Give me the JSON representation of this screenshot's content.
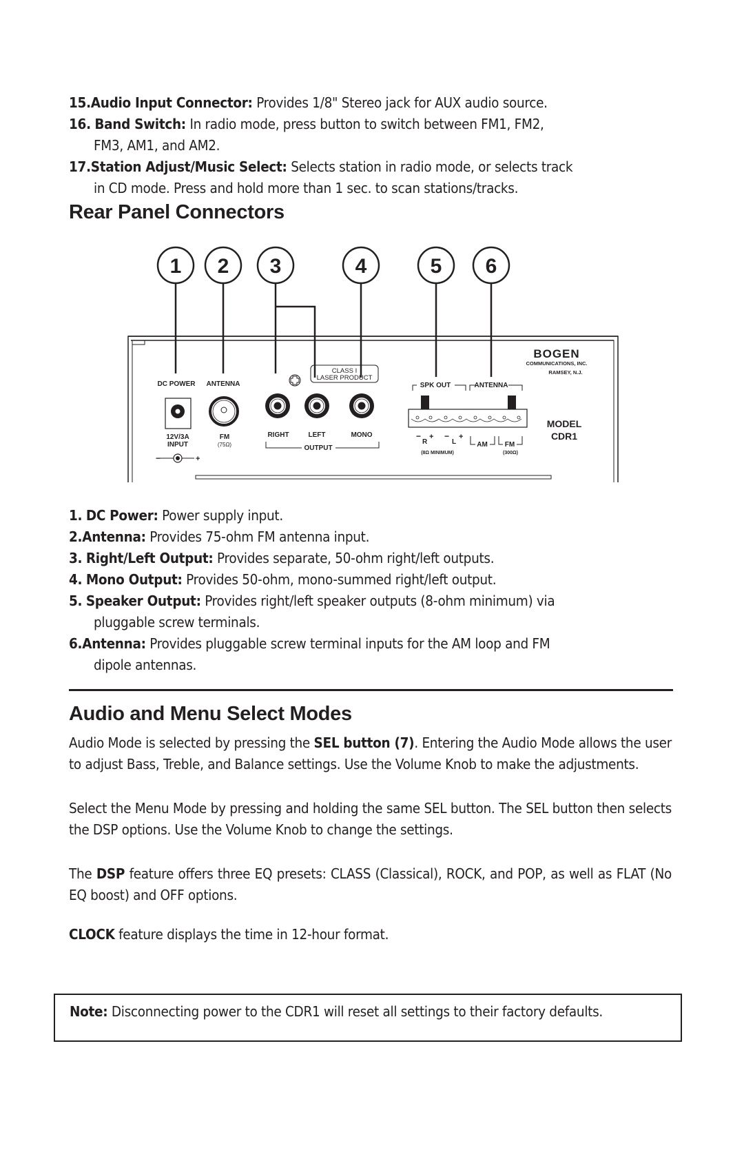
{
  "top_items": [
    {
      "num": "15.",
      "term": "Audio Input Connector:",
      "text": " Provides 1/8\" Stereo jack for AUX audio source.",
      "cont": ""
    },
    {
      "num": "16.",
      "term": "Band Switch:",
      "text": " In radio mode, press button to switch between FM1, FM2,",
      "cont": "FM3,  AM1, and AM2."
    },
    {
      "num": "17.",
      "term": "Station Adjust/Music Select:",
      "text": " Selects station in radio mode, or selects track",
      "cont": "in CD mode. Press and hold more than 1 sec. to scan stations/tracks."
    }
  ],
  "rear_panel": {
    "heading": "Rear Panel Connectors",
    "callouts": [
      "1",
      "2",
      "3",
      "4",
      "5",
      "6"
    ],
    "labels": {
      "dc_power": "DC POWER",
      "antenna": "ANTENNA",
      "dc_rating_1": "12V/3A",
      "dc_rating_2": "INPUT",
      "fm": "FM",
      "fm_ohm": "(75Ω)",
      "right": "RIGHT",
      "left": "LEFT",
      "mono": "MONO",
      "output": "OUTPUT",
      "laser_1": "CLASS I",
      "laser_2": "LASER PRODUCT",
      "spk_out": "SPK OUT",
      "antenna2": "ANTENNA",
      "r": "R",
      "l": "L",
      "am": "AM",
      "fm2": "FM",
      "min": "(8Ω MINIMUM)",
      "fm300": "(300Ω)",
      "brand": "BOGEN",
      "brand_sub": "COMMUNICATIONS, INC.",
      "brand_city": "RAMSEY, N.J.",
      "model_1": "MODEL",
      "model_2": "CDR1",
      "minus": "−",
      "plus": "+"
    }
  },
  "connector_items": [
    {
      "num": "1.",
      "term": "DC Power:",
      "text": " Power supply input.",
      "cont": ""
    },
    {
      "num": "2.",
      "term": "Antenna:",
      "text": " Provides 75-ohm FM antenna input.",
      "cont": ""
    },
    {
      "num": "3.",
      "term": "Right/Left Output:",
      "text": " Provides separate, 50-ohm right/left outputs.",
      "cont": ""
    },
    {
      "num": "4.",
      "term": "Mono Output:",
      "text": " Provides 50-ohm, mono-summed right/left output.",
      "cont": ""
    },
    {
      "num": "5.",
      "term": "Speaker Output:",
      "text": " Provides right/left speaker outputs (8-ohm minimum) via",
      "cont": "pluggable screw terminals."
    },
    {
      "num": "6.",
      "term": "Antenna:",
      "text": " Provides pluggable screw terminal inputs for the AM loop and FM",
      "cont": "dipole antennas."
    }
  ],
  "modes": {
    "heading": "Audio and Menu Select Modes",
    "p1_a": "Audio Mode is selected by pressing the ",
    "p1_b": "SEL button (7)",
    "p1_c": ". Entering the Audio Mode allows the user to adjust Bass, Treble, and Balance settings. Use the Volume Knob to make the adjustments.",
    "p2": "Select the Menu Mode by pressing and holding the same SEL button. The SEL button then selects the DSP options. Use the  Volume Knob to change the settings.",
    "p3_a": "The ",
    "p3_b": "DSP",
    "p3_c": " feature offers three EQ presets: CLASS (Classical), ROCK, and POP, as well as FLAT (No EQ boost) and OFF options.",
    "p4_a": "CLOCK",
    "p4_b": " feature displays the time in 12-hour format."
  },
  "note": {
    "label": "Note:",
    "text": " Disconnecting power to the CDR1 will reset all settings to their factory defaults."
  }
}
